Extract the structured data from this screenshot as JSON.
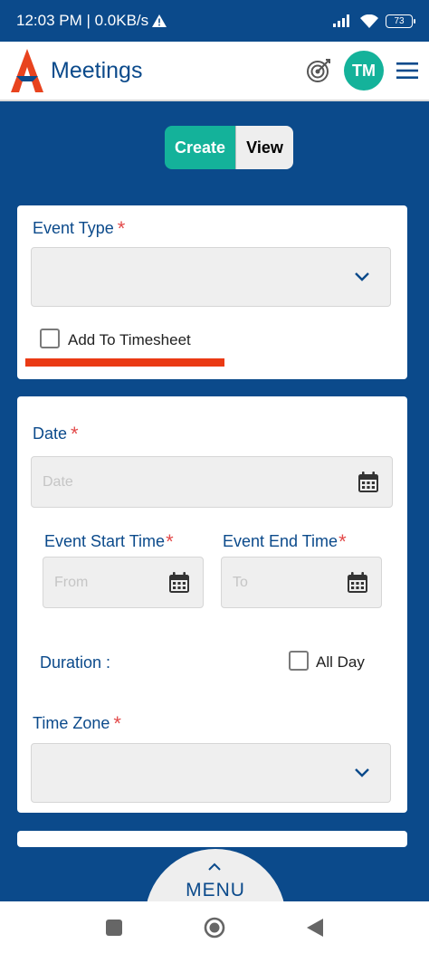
{
  "status_bar": {
    "time_info": "12:03 PM | 0.0KB/s",
    "battery": "73"
  },
  "app_bar": {
    "title": "Meetings",
    "avatar_initials": "TM"
  },
  "mode_toggle": {
    "create_label": "Create",
    "view_label": "View"
  },
  "event_type_section": {
    "event_type_label": "Event Type",
    "event_type_value": "",
    "add_to_timesheet_label": "Add To Timesheet"
  },
  "schedule_section": {
    "date_label": "Date",
    "date_placeholder": "Date",
    "start_time_label": "Event Start Time",
    "start_time_placeholder": "From",
    "end_time_label": "Event End Time",
    "end_time_placeholder": "To",
    "duration_label": "Duration :",
    "all_day_label": "All Day",
    "time_zone_label": "Time Zone",
    "time_zone_value": ""
  },
  "required_mark": "*",
  "menu": {
    "label": "MENU"
  },
  "colors": {
    "primary": "#0b4a8b",
    "accent": "#14b29a",
    "required": "#e34b4b",
    "highlight": "#ea3a14"
  }
}
